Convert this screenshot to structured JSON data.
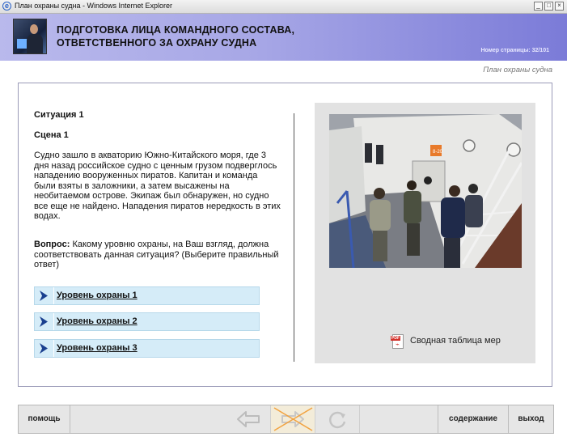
{
  "window": {
    "title": "План охраны судна - Windows Internet Explorer"
  },
  "header": {
    "title_line1": "ПОДГОТОВКА ЛИЦА КОМАНДНОГО СОСТАВА,",
    "title_line2": "ОТВЕТСТВЕННОГО ЗА ОХРАНУ СУДНА",
    "page_number": "Номер страницы: 32/101"
  },
  "section_title": "План охраны судна",
  "content": {
    "situation": "Ситуация 1",
    "scene": "Сцена 1",
    "story": "Судно зашло в акваторию Южно-Китайского моря, где 3 дня назад российское судно с ценным грузом подверглось нападению вооруженных пиратов. Капитан и команда были взяты в заложники, а затем высажены на необитаемом острове. Экипаж был обнаружен, но судно все еще не найдено. Нападения пиратов нередкость в этих водах.",
    "question_label": "Вопрос:",
    "question_text": " Какому уровню охраны, на Ваш взгляд, должна соответствовать данная ситуация? (Выберите правильный ответ)",
    "options": [
      {
        "label": "Уровень охраны 1"
      },
      {
        "label": "Уровень охраны 2"
      },
      {
        "label": "Уровень охраны 3"
      }
    ],
    "pdf_link": "Сводная таблица мер",
    "photo_sign": "8-20"
  },
  "bottom": {
    "help": "помощь",
    "contents": "содержание",
    "exit": "выход"
  },
  "colors": {
    "header_gradient": [
      "#b9b9ec",
      "#7b7bd8"
    ],
    "option_bg": "#d5ecf8",
    "arrow": "#1a3f8f"
  }
}
